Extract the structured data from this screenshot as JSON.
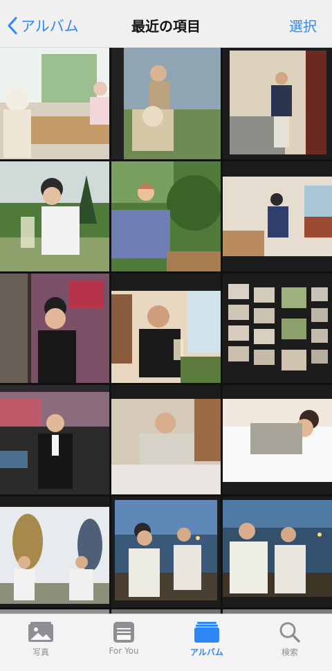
{
  "nav": {
    "back_label": "アルバム",
    "title": "最近の項目",
    "select_label": "選択"
  },
  "tabs": [
    {
      "label": "写真",
      "icon": "photo-icon",
      "active": false
    },
    {
      "label": "For You",
      "icon": "for-you-icon",
      "active": false
    },
    {
      "label": "アルバム",
      "icon": "album-icon",
      "active": true
    },
    {
      "label": "検索",
      "icon": "search-icon",
      "active": false
    }
  ],
  "colors": {
    "accent": "#2f86f6",
    "inactive": "#8e8e93"
  }
}
